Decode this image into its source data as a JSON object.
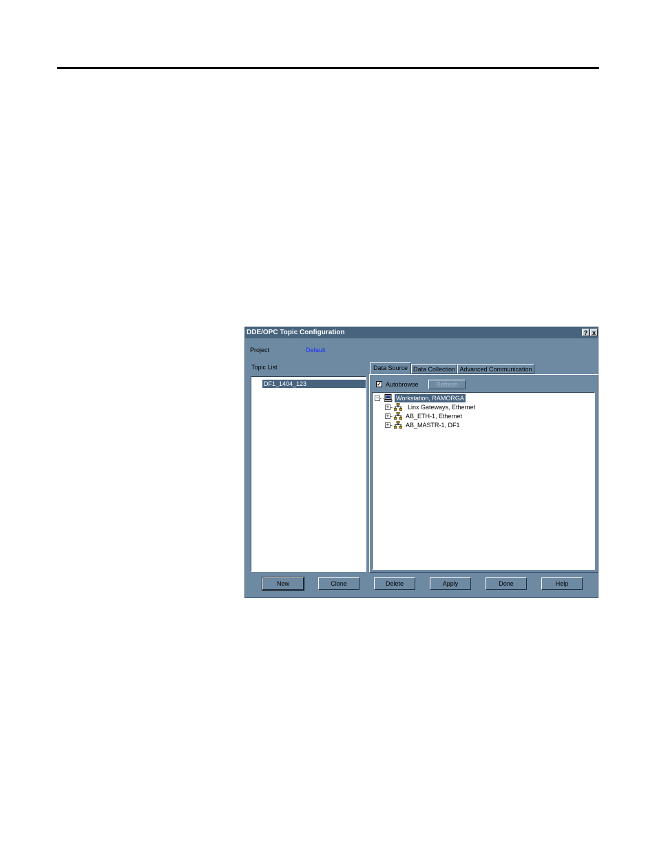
{
  "window": {
    "title": "DDE/OPC Topic Configuration",
    "help_glyph": "?",
    "close_glyph": "x"
  },
  "project": {
    "label": "Project",
    "value": "Default"
  },
  "topic_list": {
    "label": "Topic List",
    "items": [
      "DF1_1404_123"
    ]
  },
  "tabs": [
    {
      "label": "Data Source",
      "active": true
    },
    {
      "label": "Data Collection",
      "active": false
    },
    {
      "label": "Advanced Communication",
      "active": false
    }
  ],
  "data_source": {
    "autobrowse_label": "Autobrowse",
    "autobrowse_checked": true,
    "check_glyph": "✓",
    "refresh_label": "Refresh",
    "tree": {
      "root": "Workstation, RAMORGA",
      "children": [
        "Linx Gateways, Ethernet",
        "AB_ETH-1, Ethernet",
        "AB_MASTR-1, DF1"
      ],
      "collapse_glyph": "−",
      "expand_glyph": "+"
    }
  },
  "buttons": {
    "new": "New",
    "clone": "Clone",
    "delete": "Delete",
    "apply": "Apply",
    "done": "Done",
    "help": "Help"
  },
  "colors": {
    "dialog_bg": "#6e8aa3",
    "titlebar": "#47637e",
    "selection": "#47637e",
    "link_value": "#1a2cff"
  }
}
